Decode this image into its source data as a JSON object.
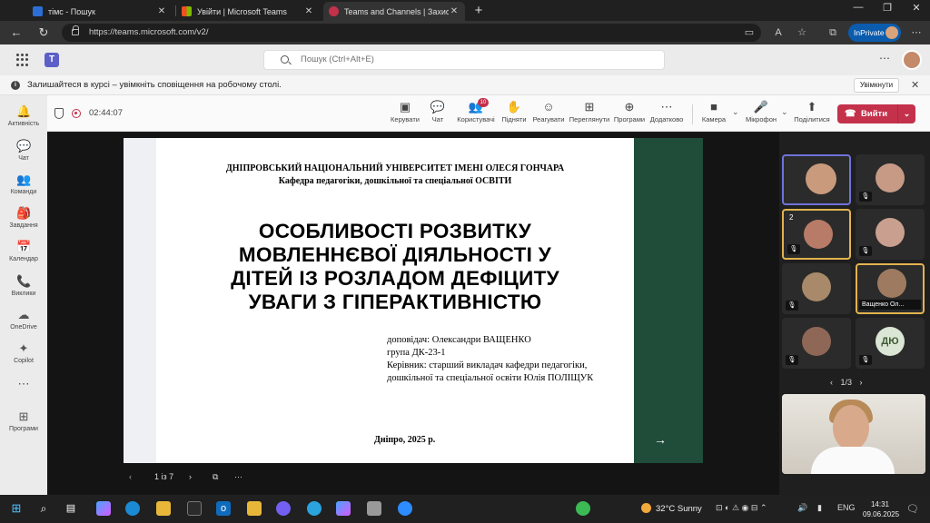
{
  "browser": {
    "tabs": [
      {
        "title": "тімс - Пошук",
        "icon_color": "#2b6fd6"
      },
      {
        "title": "Увійти | Microsoft Teams",
        "icon_color": "#f25022"
      },
      {
        "title": "Teams and Channels | Захис",
        "icon_color": "#c4314b"
      }
    ],
    "url": "https://teams.microsoft.com/v2/",
    "inprivate_label": "InPrivate"
  },
  "teams": {
    "search_placeholder": "Пошук (Ctrl+Alt+E)",
    "banner": {
      "text": "Залишайтеся в курсі – увімкніть сповіщення на робочому столі.",
      "button": "Увімкнути"
    },
    "rail": [
      {
        "label": "Активність",
        "icon": "bell-icon",
        "glyph": "🔔"
      },
      {
        "label": "Чат",
        "icon": "chat-icon",
        "glyph": "💬"
      },
      {
        "label": "Команди",
        "icon": "teams-icon",
        "glyph": "👥"
      },
      {
        "label": "Завдання",
        "icon": "assignments-icon",
        "glyph": "🎒"
      },
      {
        "label": "Календар",
        "icon": "calendar-icon",
        "glyph": "📅"
      },
      {
        "label": "Виклики",
        "icon": "calls-icon",
        "glyph": "📞"
      },
      {
        "label": "OneDrive",
        "icon": "onedrive-icon",
        "glyph": "☁"
      },
      {
        "label": "Copilot",
        "icon": "copilot-icon",
        "glyph": "✦"
      },
      {
        "label": "",
        "icon": "more-icon",
        "glyph": "⋯"
      },
      {
        "label": "Програми",
        "icon": "apps-icon",
        "glyph": "⊞"
      }
    ],
    "meeting": {
      "timer": "02:44:07",
      "toolbar": [
        {
          "label": "Керувати",
          "icon": "manage-icon",
          "glyph": "▣"
        },
        {
          "label": "Чат",
          "icon": "chat-icon",
          "glyph": "💬"
        },
        {
          "label": "Користувачі",
          "icon": "people-icon",
          "glyph": "👥",
          "badge": "10"
        },
        {
          "label": "Підняти",
          "icon": "raise-hand-icon",
          "glyph": "✋"
        },
        {
          "label": "Реагувати",
          "icon": "react-icon",
          "glyph": "☺"
        },
        {
          "label": "Переглянути",
          "icon": "view-icon",
          "glyph": "⊞"
        },
        {
          "label": "Програми",
          "icon": "apps-icon",
          "glyph": "⊕"
        },
        {
          "label": "Додатково",
          "icon": "more-icon",
          "glyph": "⋯"
        },
        {
          "label": "Камера",
          "icon": "camera-icon",
          "glyph": "■"
        },
        {
          "label": "Мікрофон",
          "icon": "mic-icon",
          "glyph": "🎤"
        },
        {
          "label": "Поділитися",
          "icon": "share-icon",
          "glyph": "⬆"
        }
      ],
      "leave_label": "Вийти",
      "slide": {
        "university": "ДНІПРОВСЬКИЙ НАЦІОНАЛЬНИЙ УНІВЕРСИТЕТ ІМЕНІ ОЛЕСЯ ГОНЧАРА",
        "department": "Кафедра педагогіки, дошкільної та спеціальної ОСВІТИ",
        "title_lines": [
          "ОСОБЛИВОСТІ РОЗВИТКУ",
          "МОВЛЕННЄВОЇ ДІЯЛЬНОСТІ У",
          "ДІТЕЙ ІЗ РОЗЛАДОМ ДЕФІЦИТУ",
          "УВАГИ З ГІПЕРАКТИВНІСТЮ"
        ],
        "info_lines": [
          "доповідач: Олександри ВАЩЕНКО",
          "група ДК-23-1",
          "Керівник: старший викладач кафедри педагогіки,",
          "дошкільної та спеціальної освіти Юлія ПОЛІЩУК"
        ],
        "city_year": "Дніпро, 2025 р.",
        "arrow": "→"
      },
      "slide_counter": "1 із 7",
      "participants": [
        {
          "face": "#c99a7c",
          "highlight": "active"
        },
        {
          "face": "#c79a86",
          "muted": true
        },
        {
          "face": "#b77b68",
          "number": "2",
          "muted": true,
          "highlight": "speaker"
        },
        {
          "face": "#c9a08f",
          "muted": true
        },
        {
          "face": "#a88a6a",
          "muted": true
        },
        {
          "face": "#9e7b60",
          "name": "Ващенко Ол...",
          "highlight": "speaker"
        },
        {
          "face": "#8f6757",
          "muted": true
        },
        {
          "initials": "ДЮ",
          "muted": true
        }
      ],
      "pager": "1/3"
    }
  },
  "taskbar": {
    "weather": "32°C  Sunny",
    "language": "ENG",
    "time": "14:31",
    "date": "09.06.2025"
  }
}
